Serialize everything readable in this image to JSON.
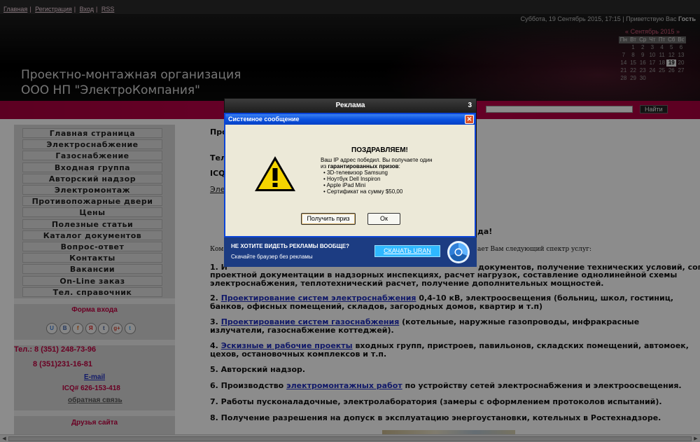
{
  "header": {
    "datetime": "Суббота, 19 Сентябрь 2015, 17:15",
    "greeting_prefix": "Приветствую Вас",
    "user": "Гость",
    "title_line1": "Проектно-монтажная организация",
    "title_line2": "ООО НП \"ЭлектроКомпания\""
  },
  "calendar": {
    "prev": "«",
    "month": "Сентябрь 2015",
    "next": "»",
    "dow": [
      "Пн",
      "Вт",
      "Ср",
      "Чт",
      "Пт",
      "Сб",
      "Вс"
    ],
    "weeks": [
      [
        "",
        "1",
        "2",
        "3",
        "4",
        "5",
        "6"
      ],
      [
        "7",
        "8",
        "9",
        "10",
        "11",
        "12",
        "13"
      ],
      [
        "14",
        "15",
        "16",
        "17",
        "18",
        "19",
        "20"
      ],
      [
        "21",
        "22",
        "23",
        "24",
        "25",
        "26",
        "27"
      ],
      [
        "28",
        "29",
        "30",
        "",
        "",
        "",
        ""
      ]
    ],
    "today": "19"
  },
  "nav": {
    "links": [
      "Главная",
      "Регистрация",
      "Вход",
      "RSS"
    ],
    "search_button": "Найти"
  },
  "sidebar": {
    "menu": [
      "Главная страница",
      "Электроснабжение",
      "Газоснабжение",
      "Входная группа",
      "Авторский надзор",
      "Электромонтаж",
      "Противопожарные двери",
      "Цены",
      "Полезные статьи",
      "Каталог документов",
      "Вопрос-ответ",
      "Контакты",
      "Вакансии",
      "On-Line заказ",
      "Тел. справочник"
    ],
    "login_title": "Форма входа",
    "social": [
      "U",
      "В",
      "f",
      "Я",
      "t",
      "g+",
      "t"
    ],
    "phone1": "Тел.: 8 (351) 248-73-96",
    "phone2": "8 (351)231-16-81",
    "email": "E-mail",
    "icq": "ICQ# 626-153-418",
    "feedback": "обратная связь",
    "friends_title": "Друзья сайта"
  },
  "content": {
    "frag_pro": "Про",
    "frag_tel": "Тел",
    "frag_icq": "ICQ-",
    "frag_ele": "Элек",
    "frag_da": "да!",
    "frag_kom": "Ком",
    "frag_spectr": "ает Вам следующий спектр услуг:",
    "p1_lead": "1. И",
    "p1_text": "проектной документации в надзорных инспекциях, расчет нагрузок,  составление однолинейной схемы электроснабжения, теплотехнический расчет, получение дополнительных мощностей.",
    "p1_tail": "документов, получение технических условий, согласование",
    "p2_num": "2.",
    "p2_link": "Проектирование систем электроснабжения",
    "p2_text": "0,4-10 кВ, электроосвещения (больниц, школ, гостиниц, банков, офисных помещений, складов, загородных домов, квартир и т.п)",
    "p3_num": "3.",
    "p3_link": "Проектирование систем газоснабжения",
    "p3_text": "(котельные, наружные газопроводы, инфракрасные излучатели, газоснабжение коттеджей).",
    "p4_num": "4.",
    "p4_link": "Эскизные и рабочие проекты",
    "p4_text": "входных групп, пристроев, павильонов, складских помещений, автомоек, цехов, остановочных комплексов и т.п.",
    "p5": "5. Авторский надзор.",
    "p6_pre": "6. Производство",
    "p6_link": "электромонтажных работ",
    "p6_text": "по устройству сетей электроснабжения и электроосвещения.",
    "p7": "7. Работы пусконаладочные, электролаборатория (замеры с оформлением протоколов испытаний).",
    "p8": "8. Получение разрешения на допуск в эксплуатацию энергоустановки, котельных в Ростехнадзоре."
  },
  "ad": {
    "title": "Реклама",
    "countdown": "3",
    "dialog_title": "Системное сообщение",
    "close": "✕",
    "congrats": "ПОЗДРАВЛЯЕМ!",
    "msg_line1": "Ваш IP адрес победил. Вы получаете один",
    "msg_line2_pre": "из",
    "msg_line2_bold": "гарантированных призов",
    "msg_line2_post": ":",
    "prizes": [
      "• 3D-телевизор Samsung",
      "• Ноутбук Dell Inspiron",
      "• Apple iPad Mini",
      "• Сертификат на сумму $50,00"
    ],
    "btn_get": "Получить приз",
    "btn_ok": "Ок",
    "promo_question": "НЕ ХОТИТЕ ВИДЕТЬ РЕКЛАМЫ ВООБЩЕ?",
    "promo_sub": "Скачайте браузер без рекламы",
    "promo_button": "СКАЧАТЬ URAN"
  }
}
